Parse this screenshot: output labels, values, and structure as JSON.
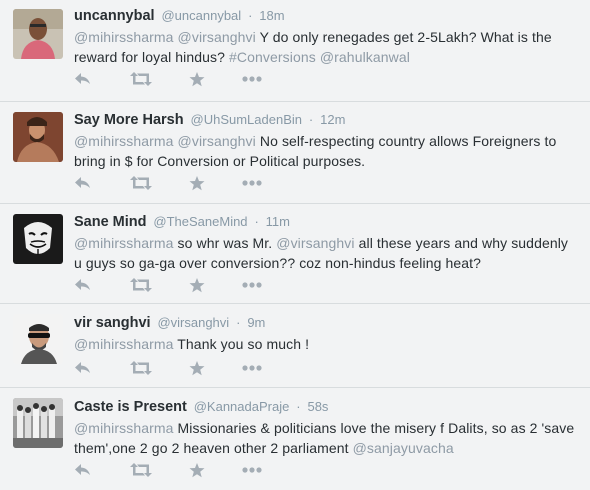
{
  "tweets": [
    {
      "fullname": "uncannybal",
      "handle": "@uncannybal",
      "separator": "·",
      "time": "18m",
      "text": [
        {
          "t": "mention",
          "v": "@mihirssharma"
        },
        {
          "t": "plain",
          "v": " "
        },
        {
          "t": "mention",
          "v": "@virsanghvi"
        },
        {
          "t": "plain",
          "v": " Y do only renegades get 2-5Lakh? What is the reward for loyal hindus? "
        },
        {
          "t": "hashtag",
          "v": "#Conversions"
        },
        {
          "t": "plain",
          "v": " "
        },
        {
          "t": "mention",
          "v": "@rahulkanwal"
        }
      ],
      "avatar": "man-in-pink-shirt"
    },
    {
      "fullname": "Say More Harsh",
      "handle": "@UhSumLadenBin",
      "separator": "·",
      "time": "12m",
      "text": [
        {
          "t": "mention",
          "v": "@mihirssharma"
        },
        {
          "t": "plain",
          "v": " "
        },
        {
          "t": "mention",
          "v": "@virsanghvi"
        },
        {
          "t": "plain",
          "v": " No self-respecting country allows Foreigners to bring in $ for Conversion or Political purposes."
        }
      ],
      "avatar": "bearded-man-with-dog"
    },
    {
      "fullname": "Sane Mind",
      "handle": "@TheSaneMind",
      "separator": "·",
      "time": "11m",
      "text": [
        {
          "t": "mention",
          "v": "@mihirssharma"
        },
        {
          "t": "plain",
          "v": " so whr was Mr. "
        },
        {
          "t": "mention",
          "v": "@virsanghvi"
        },
        {
          "t": "plain",
          "v": "  all these years and why suddenly u guys so ga-ga over conversion?? coz non-hindus feeling heat?"
        }
      ],
      "avatar": "guy-fawkes-mask"
    },
    {
      "fullname": "vir sanghvi",
      "handle": "@virsanghvi",
      "separator": "·",
      "time": "9m",
      "text": [
        {
          "t": "mention",
          "v": "@mihirssharma"
        },
        {
          "t": "plain",
          "v": " Thank you  so much !"
        }
      ],
      "avatar": "man-with-sunglasses"
    },
    {
      "fullname": "Caste is Present",
      "handle": "@KannadaPraje",
      "separator": "·",
      "time": "58s",
      "text": [
        {
          "t": "mention",
          "v": "@mihirssharma"
        },
        {
          "t": "plain",
          "v": " Missionaries & politicians love the misery f Dalits, so as 2 'save them',one 2 go 2 heaven other 2 parliament "
        },
        {
          "t": "mention",
          "v": "@sanjayuvacha"
        }
      ],
      "avatar": "group-photo"
    }
  ],
  "actions": [
    "reply-icon",
    "retweet-icon",
    "favorite-icon",
    "more-icon"
  ],
  "colors": {
    "background": "#f2f3f4",
    "name": "#292f33",
    "meta": "#8899a6",
    "link": "#8e9aa5",
    "icon": "#a4adb5",
    "divider": "#d8dcde"
  }
}
